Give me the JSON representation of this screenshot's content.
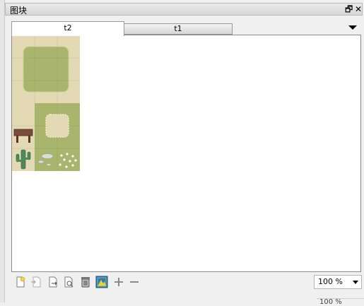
{
  "panel": {
    "title": "图块",
    "float_glyph": "🗗",
    "close_glyph": "✕"
  },
  "tabs": [
    {
      "label": "t2",
      "active": true
    },
    {
      "label": "t1",
      "active": false
    }
  ],
  "toolbar": {
    "icons": [
      "new-tileset-icon",
      "embed-tileset-icon",
      "export-tileset-icon",
      "edit-tileset-icon",
      "delete-tileset-icon",
      "image-tileset-icon",
      "add-icon",
      "remove-icon"
    ]
  },
  "zoom": {
    "value": "100 %",
    "partial_value": "100 %"
  },
  "colors": {
    "sand": "#e3d9b4",
    "grass": "#a9b56d",
    "wood": "#7a4b3a",
    "cactus": "#4e8a58"
  }
}
